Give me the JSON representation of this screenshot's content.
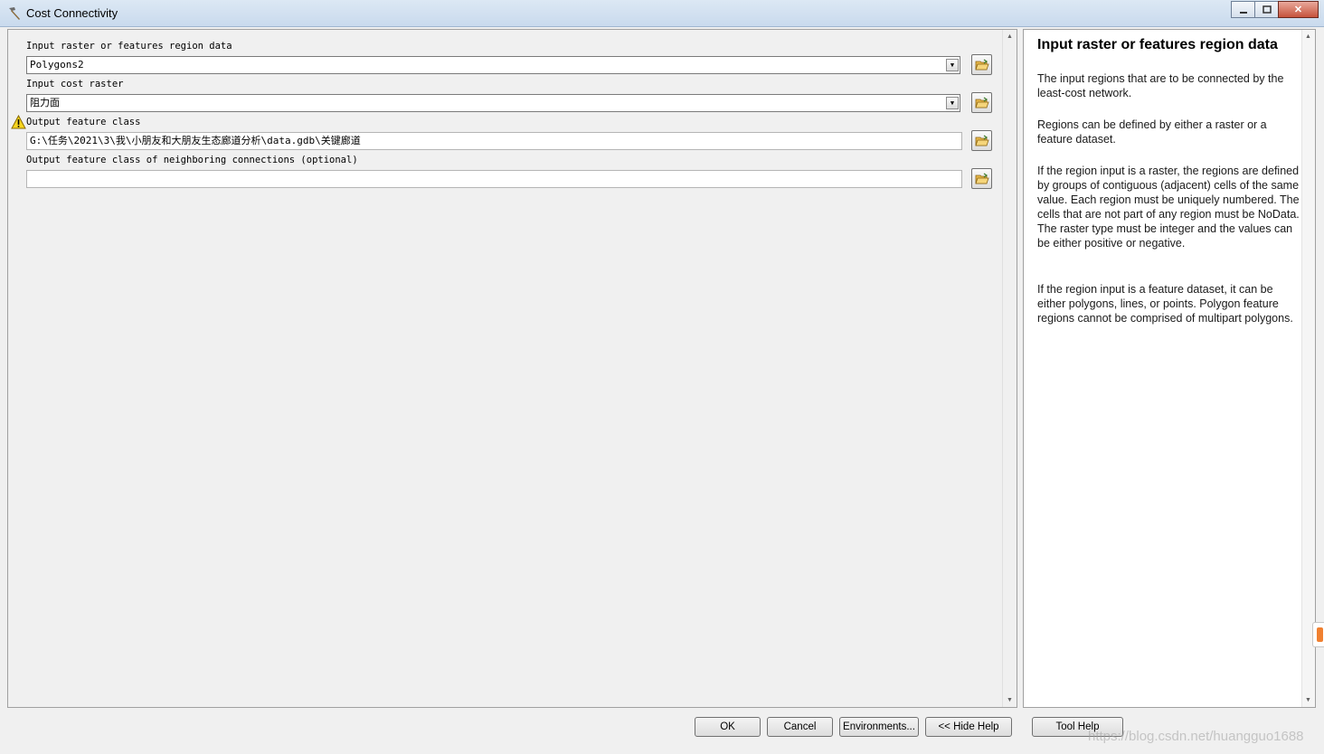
{
  "window": {
    "title": "Cost Connectivity",
    "minimize_label": "▭",
    "maximize_label": "◻",
    "close_label": "✕"
  },
  "params": [
    {
      "label": "Input raster or features region data",
      "value": "Polygons2",
      "type": "dropdown"
    },
    {
      "label": "Input cost raster",
      "value": "阻力面",
      "type": "dropdown"
    },
    {
      "label": "Output feature class",
      "value": "G:\\任务\\2021\\3\\我\\小朋友和大朋友生态廊道分析\\data.gdb\\关键廊道",
      "type": "text",
      "warning": true
    },
    {
      "label": "Output feature class of neighboring connections (optional)",
      "value": "",
      "type": "text"
    }
  ],
  "help": {
    "title": "Input raster or features region data",
    "paragraphs": [
      "The input regions that are to be connected by the least-cost network.",
      "Regions can be defined by either a raster or a feature dataset.",
      "If the region input is a raster, the regions are defined by groups of contiguous (adjacent) cells of the same value. Each region must be uniquely numbered. The cells that are not part of any region must be NoData. The raster type must be integer and the values can be either positive or negative.",
      "If the region input is a feature dataset, it can be either polygons, lines, or points. Polygon feature regions cannot be comprised of multipart polygons."
    ]
  },
  "buttons": {
    "ok": "OK",
    "cancel": "Cancel",
    "environments": "Environments...",
    "hide_help": "<< Hide Help",
    "tool_help": "Tool Help"
  },
  "watermark": "https://blog.csdn.net/huangguo1688"
}
